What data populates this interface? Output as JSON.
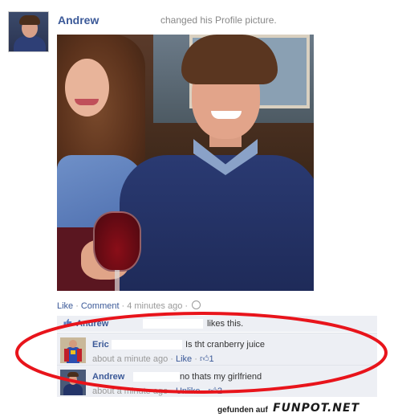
{
  "post": {
    "author": "Andrew",
    "story": "changed his Profile picture.",
    "actions": {
      "like": "Like",
      "comment": "Comment",
      "time": "4 minutes ago"
    }
  },
  "likes": {
    "liker": "Andrew",
    "text": "likes this."
  },
  "comments": [
    {
      "name": "Eric",
      "text": "Is tht cranberry juice",
      "time": "about a minute ago",
      "action": "Like",
      "like_count": "1"
    },
    {
      "name": "Andrew",
      "text": "no thats my girlfriend",
      "time": "about a minute ago",
      "action": "Unlike",
      "like_count": "2"
    }
  ],
  "watermark": {
    "prefix": "gefunden auf",
    "site": "FUNPOT.NET"
  },
  "colors": {
    "link": "#3b5998",
    "comment_bg": "#edeff4",
    "highlight": "#e8141b"
  }
}
